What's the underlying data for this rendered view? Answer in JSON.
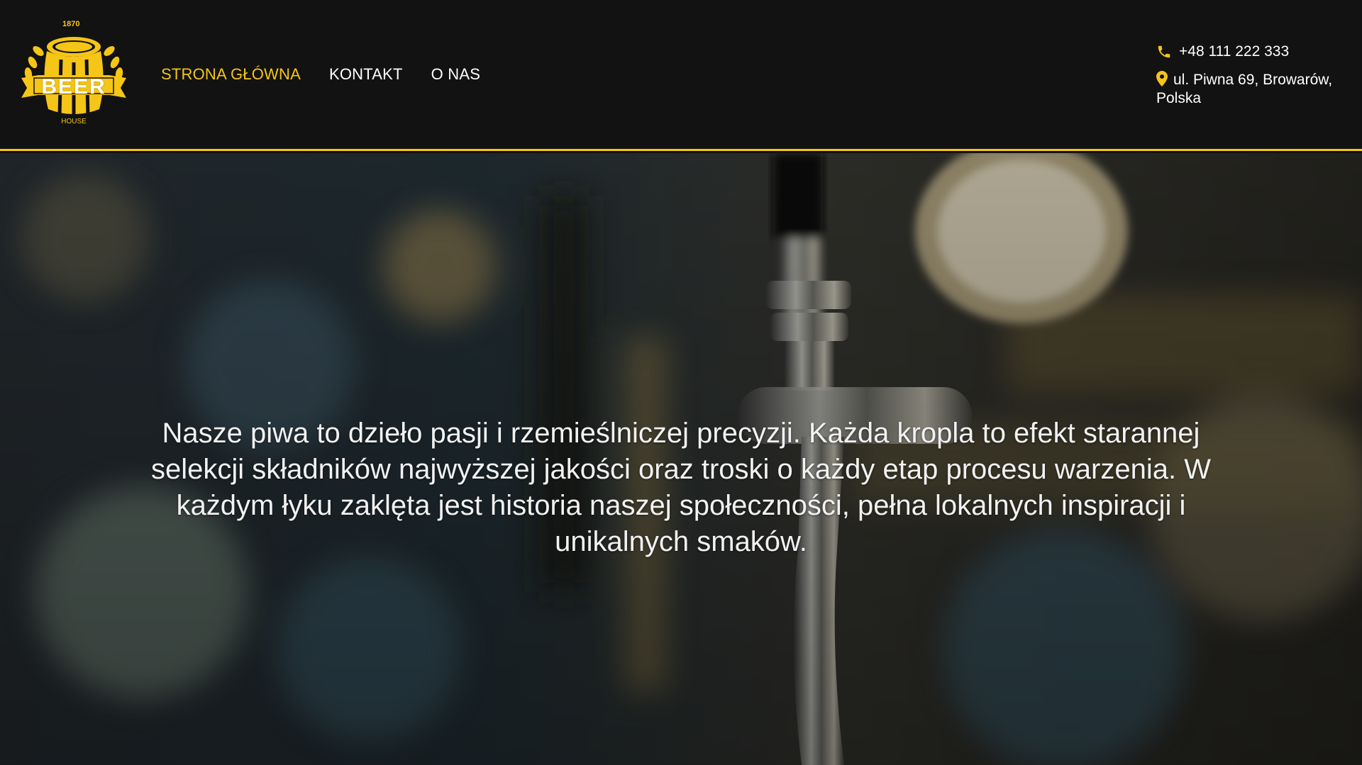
{
  "logo": {
    "year": "1870",
    "name": "BEER",
    "sub": "HOUSE"
  },
  "nav": {
    "items": [
      {
        "label": "STRONA GŁÓWNA",
        "active": true
      },
      {
        "label": "KONTAKT",
        "active": false
      },
      {
        "label": "O NAS",
        "active": false
      }
    ]
  },
  "contact": {
    "phone": "+48 111 222 333",
    "address": "ul. Piwna 69, Browarów, Polska",
    "phone_icon": "phone-icon",
    "address_icon": "map-pin-icon"
  },
  "hero": {
    "text": "Nasze piwa to dzieło pasji i rzemieślniczej precyzji. Każda kropla to efekt starannej selekcji składników najwyższej jakości oraz troski o każdy etap procesu warzenia. W każdym łyku zaklęta jest historia naszej społeczności, pełna lokalnych inspiracji i unikalnych smaków."
  },
  "colors": {
    "accent": "#f5c518",
    "header_bg": "#121212",
    "text": "#ffffff"
  }
}
